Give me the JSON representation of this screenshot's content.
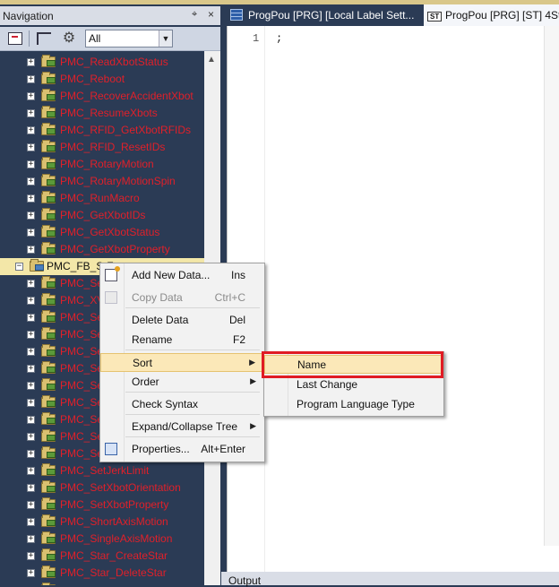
{
  "navigation": {
    "title": "Navigation",
    "pin_glyph": "Δ",
    "close_glyph": "×",
    "toolbar": {
      "filter_value": "All"
    },
    "tree_items": [
      {
        "label": "PMC_ReadXbotStatus",
        "level": "child"
      },
      {
        "label": "PMC_Reboot",
        "level": "child"
      },
      {
        "label": "PMC_RecoverAccidentXbot",
        "level": "child"
      },
      {
        "label": "PMC_ResumeXbots",
        "level": "child"
      },
      {
        "label": "PMC_RFID_GetXbotRFIDs",
        "level": "child"
      },
      {
        "label": "PMC_RFID_ResetIDs",
        "level": "child"
      },
      {
        "label": "PMC_RotaryMotion",
        "level": "child"
      },
      {
        "label": "PMC_RotaryMotionSpin",
        "level": "child"
      },
      {
        "label": "PMC_RunMacro",
        "level": "child"
      },
      {
        "label": "PMC_GetXbotIDs",
        "level": "child"
      },
      {
        "label": "PMC_GetXbotStatus",
        "level": "child"
      },
      {
        "label": "PMC_GetXbotProperty",
        "level": "child"
      },
      {
        "label": "PMC_FB_S-Z",
        "level": "top"
      },
      {
        "label": "PMC_Se",
        "level": "child"
      },
      {
        "label": "PMC_XV",
        "level": "child"
      },
      {
        "label": "PMC_Se",
        "level": "child"
      },
      {
        "label": "PMC_Se",
        "level": "child"
      },
      {
        "label": "PMC_Se",
        "level": "child"
      },
      {
        "label": "PMC_Se",
        "level": "child"
      },
      {
        "label": "PMC_Se",
        "level": "child"
      },
      {
        "label": "PMC_Se",
        "level": "child"
      },
      {
        "label": "PMC_Se",
        "level": "child"
      },
      {
        "label": "PMC_Se",
        "level": "child"
      },
      {
        "label": "PMC_Se",
        "level": "child"
      },
      {
        "label": "PMC_SetJerkLimit",
        "level": "child"
      },
      {
        "label": "PMC_SetXbotOrientation",
        "level": "child"
      },
      {
        "label": "PMC_SetXbotProperty",
        "level": "child"
      },
      {
        "label": "PMC_ShortAxisMotion",
        "level": "child"
      },
      {
        "label": "PMC_SingleAxisMotion",
        "level": "child"
      },
      {
        "label": "PMC_Star_CreateStar",
        "level": "child"
      },
      {
        "label": "PMC_Star_DeleteStar",
        "level": "child"
      },
      {
        "label": "PMC_Star_GetStarStatus",
        "level": "child"
      }
    ]
  },
  "editor": {
    "tabs": [
      {
        "label": "ProgPou [PRG] [Local Label Sett...",
        "icon": "grid-icon"
      },
      {
        "label": "ProgPou [PRG] [ST] 4Ste",
        "icon": "st-icon",
        "icon_text": "ST"
      }
    ],
    "line_number": "1",
    "code_line": ";"
  },
  "output_panel": {
    "title": "Output"
  },
  "context_menu": {
    "items": [
      {
        "label": "Add New Data...",
        "shortcut": "Ins",
        "enabled": true
      },
      {
        "label": "Copy Data",
        "shortcut": "Ctrl+C",
        "enabled": false
      },
      {
        "label": "Delete Data",
        "shortcut": "Del",
        "enabled": true
      },
      {
        "label": "Rename",
        "shortcut": "F2",
        "enabled": true
      },
      {
        "label": "Sort",
        "shortcut": "",
        "enabled": true
      },
      {
        "label": "Order",
        "shortcut": "",
        "enabled": true
      },
      {
        "label": "Check Syntax",
        "shortcut": "",
        "enabled": true
      },
      {
        "label": "Expand/Collapse Tree",
        "shortcut": "",
        "enabled": true
      },
      {
        "label": "Properties...",
        "shortcut": "Alt+Enter",
        "enabled": true
      }
    ],
    "arrow_glyph": "▶"
  },
  "sort_submenu": {
    "items": [
      "Name",
      "Last Change",
      "Program Language Type"
    ]
  },
  "colors": {
    "nav_background": "#2b3b55",
    "tree_item_text": "#e0202a",
    "highlight": "#fbe8b8",
    "annotation_box": "#e01b24"
  }
}
